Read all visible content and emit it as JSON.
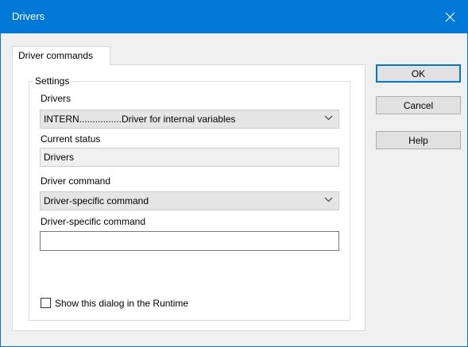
{
  "window": {
    "title": "Drivers"
  },
  "tabs": [
    {
      "label": "Driver commands"
    }
  ],
  "settings": {
    "legend": "Settings",
    "drivers": {
      "label": "Drivers",
      "value": "INTERN................Driver for internal variables"
    },
    "current_status": {
      "label": "Current status",
      "value": "Drivers"
    },
    "driver_command": {
      "label": "Driver command",
      "value": "Driver-specific command"
    },
    "driver_specific_command": {
      "label": "Driver-specific command",
      "value": ""
    },
    "show_in_runtime": {
      "label": "Show this dialog in the Runtime",
      "checked": false
    }
  },
  "buttons": {
    "ok": "OK",
    "cancel": "Cancel",
    "help": "Help"
  },
  "colors": {
    "titlebar": "#0078d7",
    "accent": "#0078d7"
  },
  "icons": {
    "close": "close-icon",
    "dropdown": "chevron-down-icon"
  }
}
